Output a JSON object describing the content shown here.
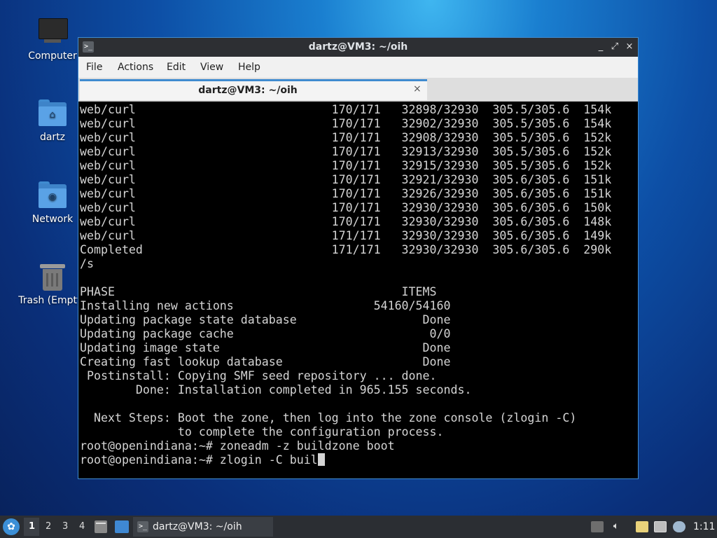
{
  "desktop": {
    "icons": [
      {
        "label": "Computer"
      },
      {
        "label": "dartz"
      },
      {
        "label": "Network"
      },
      {
        "label": "Trash (Empty)"
      }
    ]
  },
  "window": {
    "title": "dartz@VM3: ~/oih",
    "menu": [
      "File",
      "Actions",
      "Edit",
      "View",
      "Help"
    ],
    "tab_title": "dartz@VM3: ~/oih",
    "tab_close": "×",
    "controls": {
      "minimize": "_",
      "maximize": "⤢",
      "close": "×"
    }
  },
  "terminal": {
    "text": "web/curl                            170/171   32898/32930  305.5/305.6  154k\nweb/curl                            170/171   32902/32930  305.5/305.6  154k\nweb/curl                            170/171   32908/32930  305.5/305.6  152k\nweb/curl                            170/171   32913/32930  305.5/305.6  152k\nweb/curl                            170/171   32915/32930  305.5/305.6  152k\nweb/curl                            170/171   32921/32930  305.6/305.6  151k\nweb/curl                            170/171   32926/32930  305.6/305.6  151k\nweb/curl                            170/171   32930/32930  305.6/305.6  150k\nweb/curl                            170/171   32930/32930  305.6/305.6  148k\nweb/curl                            171/171   32930/32930  305.6/305.6  149k\nCompleted                           171/171   32930/32930  305.6/305.6  290k\n/s\n\nPHASE                                         ITEMS\nInstalling new actions                    54160/54160\nUpdating package state database                  Done\nUpdating package cache                            0/0\nUpdating image state                             Done\nCreating fast lookup database                    Done\n Postinstall: Copying SMF seed repository ... done.\n        Done: Installation completed in 965.155 seconds.\n\n  Next Steps: Boot the zone, then log into the zone console (zlogin -C)\n              to complete the configuration process.\nroot@openindiana:~# zoneadm -z buildzone boot\nroot@openindiana:~# zlogin -C buil"
  },
  "taskbar": {
    "workspaces": [
      "1",
      "2",
      "3",
      "4"
    ],
    "task_title": "dartz@VM3: ~/oih",
    "clock": "1:11"
  }
}
